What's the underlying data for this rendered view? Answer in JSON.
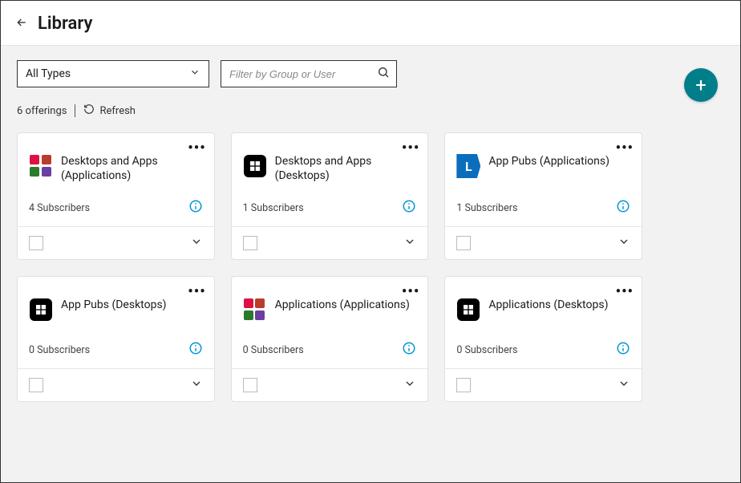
{
  "header": {
    "title": "Library"
  },
  "toolbar": {
    "type_filter": "All Types",
    "search_placeholder": "Filter by Group or User"
  },
  "meta": {
    "count_label": "6 offerings",
    "refresh_label": "Refresh"
  },
  "cards": [
    {
      "title": "Desktops and Apps (Applications)",
      "subscribers": "4 Subscribers",
      "icon": "apps"
    },
    {
      "title": "Desktops and Apps (Desktops)",
      "subscribers": "1 Subscribers",
      "icon": "win"
    },
    {
      "title": "App Pubs (Applications)",
      "subscribers": "1 Subscribers",
      "icon": "L"
    },
    {
      "title": "App Pubs (Desktops)",
      "subscribers": "0 Subscribers",
      "icon": "win"
    },
    {
      "title": "Applications (Applications)",
      "subscribers": "0 Subscribers",
      "icon": "apps"
    },
    {
      "title": "Applications (Desktops)",
      "subscribers": "0 Subscribers",
      "icon": "win"
    }
  ]
}
